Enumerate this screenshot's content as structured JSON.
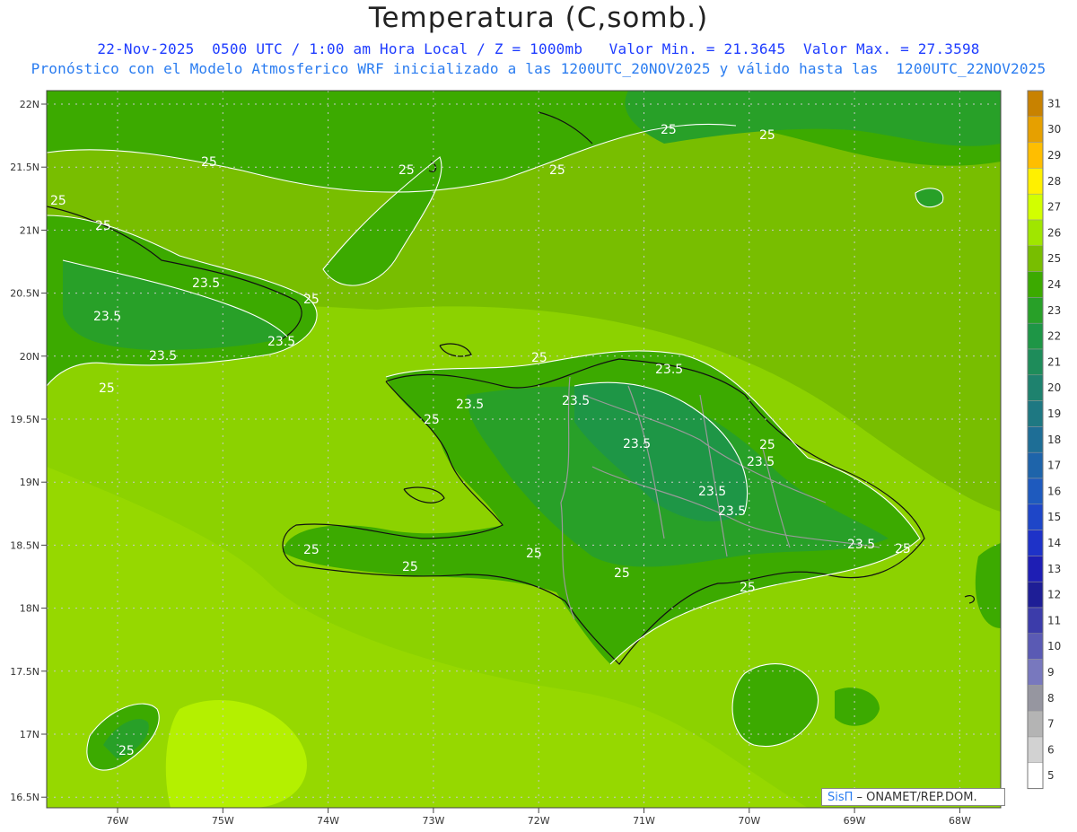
{
  "header": {
    "title": "Temperatura (C,somb.)",
    "line1": "22-Nov-2025  0500 UTC / 1:00 am Hora Local / Z = 1000mb   Valor Min. = 21.3645  Valor Max. = 27.3598",
    "line2": "Pronóstico con el Modelo Atmosferico WRF inicializado a las 1200UTC_20NOV2025 y válido hasta las  1200UTC_22NOV2025"
  },
  "axes": {
    "lat_labels": [
      "22N",
      "21.5N",
      "21N",
      "20.5N",
      "20N",
      "19.5N",
      "19N",
      "18.5N",
      "18N",
      "17.5N",
      "17N",
      "16.5N"
    ],
    "lon_labels": [
      "76W",
      "75W",
      "74W",
      "73W",
      "72W",
      "71W",
      "70W",
      "69W",
      "68W"
    ]
  },
  "colorbar": {
    "labels": [
      "31",
      "30",
      "29",
      "28",
      "27",
      "26",
      "25",
      "24",
      "23",
      "22",
      "21",
      "20",
      "19",
      "18",
      "17",
      "16",
      "15",
      "14",
      "13",
      "12",
      "11",
      "10",
      "9",
      "8",
      "7",
      "6",
      "5"
    ],
    "colors": [
      "#c88200",
      "#e6a000",
      "#ffbe00",
      "#fff000",
      "#d2ff00",
      "#a0e600",
      "#78be00",
      "#3caa00",
      "#28a028",
      "#1e9646",
      "#1e8c5a",
      "#1e826e",
      "#1e7882",
      "#1e6e96",
      "#1e64aa",
      "#1e5abe",
      "#1e46c8",
      "#1e32c8",
      "#1e1eb4",
      "#1e1e96",
      "#3c3caa",
      "#5a5ab4",
      "#7878be",
      "#9696a0",
      "#b4b4b4",
      "#d2d2d2",
      "#ffffff"
    ]
  },
  "contour_labels": [
    "25",
    "23.5"
  ],
  "credit": {
    "brand": "SisΠ",
    "text": " – ONAMET/REP.DOM."
  }
}
